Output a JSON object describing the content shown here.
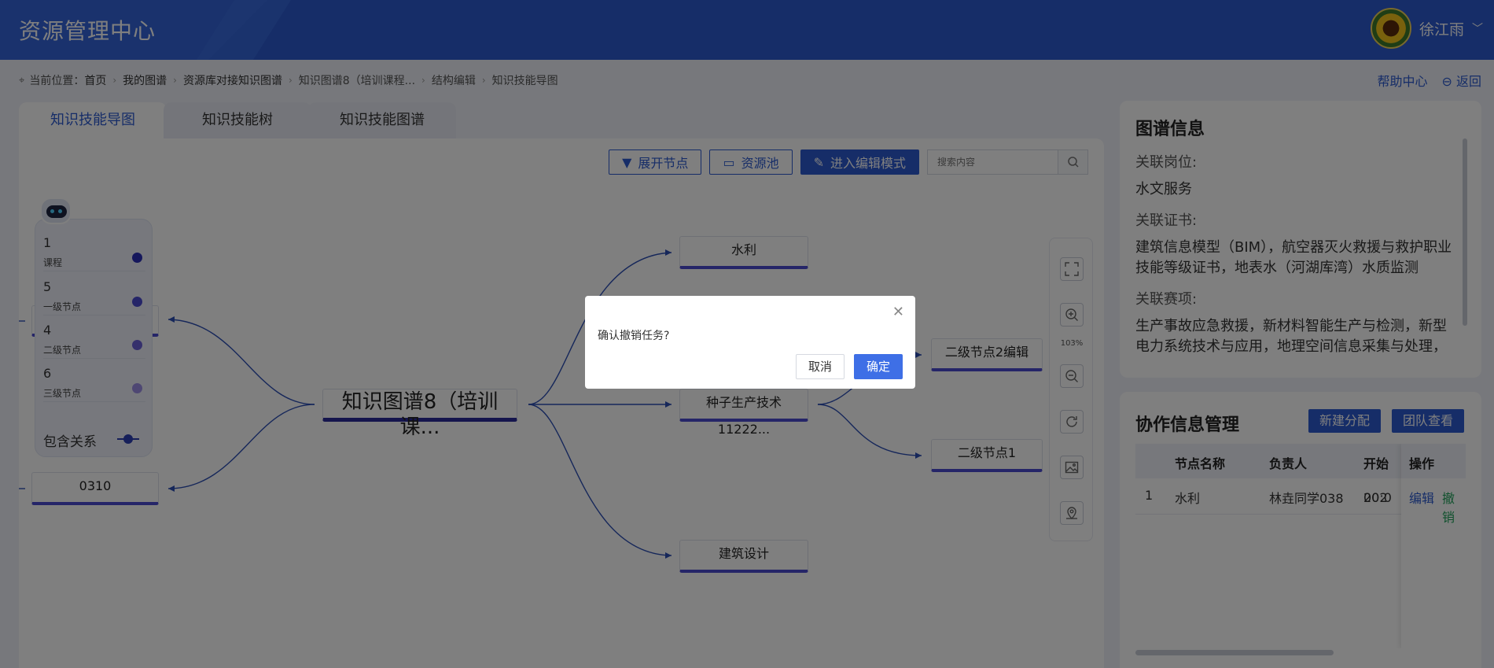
{
  "header": {
    "title": "资源管理中心",
    "user_name": "徐江雨"
  },
  "breadcrumb": {
    "prefix": "当前位置：",
    "items": [
      "首页",
      "我的图谱",
      "资源库对接知识图谱",
      "知识图谱8（培训课程...",
      "结构编辑",
      "知识技能导图"
    ]
  },
  "top_links": {
    "help": "帮助中心",
    "back": "返回"
  },
  "tabs": [
    "知识技能导图",
    "知识技能树",
    "知识技能图谱"
  ],
  "toolbar": {
    "expand": "展开节点",
    "resource_pool": "资源池",
    "edit_mode": "进入编辑模式",
    "search_placeholder": "搜索内容"
  },
  "mindmap": {
    "root": "知识图谱8（培训课...",
    "left_nodes": [
      "",
      "0310"
    ],
    "right_nodes": [
      "水利",
      "种子生产技术11222...",
      "建筑设计"
    ],
    "level2_nodes": [
      "二级节点2编辑",
      "二级节点1"
    ]
  },
  "legend": {
    "items": [
      {
        "count": "1",
        "label": "课程",
        "color": "#2b2fb8"
      },
      {
        "count": "5",
        "label": "一级节点",
        "color": "#4a4ad0"
      },
      {
        "count": "4",
        "label": "二级节点",
        "color": "#6a60d8"
      },
      {
        "count": "6",
        "label": "三级节点",
        "color": "#9c8ee6"
      }
    ],
    "relation": "包含关系"
  },
  "zoom": {
    "level": "103%"
  },
  "graph_info": {
    "title": "图谱信息",
    "post_label": "关联岗位:",
    "post_value": "水文服务",
    "cert_label": "关联证书:",
    "cert_value": "建筑信息模型（BIM），航空器灭火救援与救护职业技能等级证书，地表水（河湖库湾）水质监测",
    "comp_label": "关联赛项:",
    "comp_value": "生产事故应急救援，新材料智能生产与检测，新型电力系统技术与应用，地理空间信息采集与处理，"
  },
  "collab": {
    "title": "协作信息管理",
    "new_assign": "新建分配",
    "team_view": "团队查看",
    "columns": [
      "节点名称",
      "负责人",
      "开始",
      "操作"
    ],
    "rows": [
      {
        "index": "1",
        "node": "水利",
        "owner": "林垚同学038",
        "start": "202",
        "start2": "00:0"
      }
    ],
    "edit": "编辑",
    "revoke": "撤销"
  },
  "modal": {
    "message": "确认撤销任务?",
    "cancel": "取消",
    "confirm": "确定"
  }
}
